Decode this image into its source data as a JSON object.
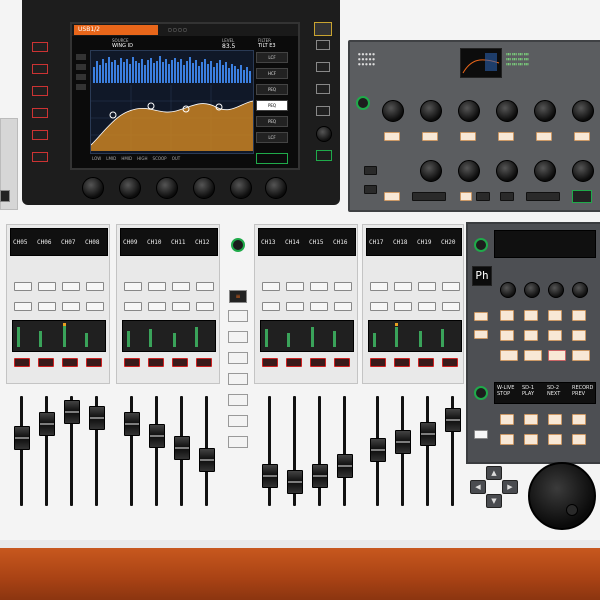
{
  "screen": {
    "tab_label": "USB1/2",
    "source_label": "SOURCE",
    "source_value": "WING ID",
    "level_label": "LEVEL",
    "level_value": "83.5",
    "filter_label": "FILTER",
    "filter_value": "TILT E3",
    "side_buttons": [
      "LCF",
      "HCF",
      "PEQ",
      "PEQ",
      "PEQ",
      "LCF"
    ],
    "selected_side_index": 3,
    "bottom_labels": [
      "LOW",
      "LMID",
      "HMID",
      "HIGH",
      "SCOOP",
      "OUT"
    ]
  },
  "lcd_channels": {
    "bay1": [
      "CH05",
      "CH06",
      "CH07",
      "CH08"
    ],
    "bay2": [
      "CH09",
      "CH10",
      "CH11",
      "CH12"
    ],
    "bay3": [
      "CH13",
      "CH14",
      "CH15",
      "CH16"
    ],
    "bay4": [
      "CH17",
      "CH18",
      "CH19",
      "CH20"
    ]
  },
  "right_panel": {
    "display_text": "Ph",
    "transport_labels": [
      "W-LIVE STOP",
      "SD-1 PLAY",
      "SD-2 NEXT",
      "RECORD PREV"
    ]
  },
  "colors": {
    "accent_orange": "#e8661a",
    "mute_red": "#cc2222",
    "green": "#1faa4a",
    "wood": "#b04a18"
  }
}
